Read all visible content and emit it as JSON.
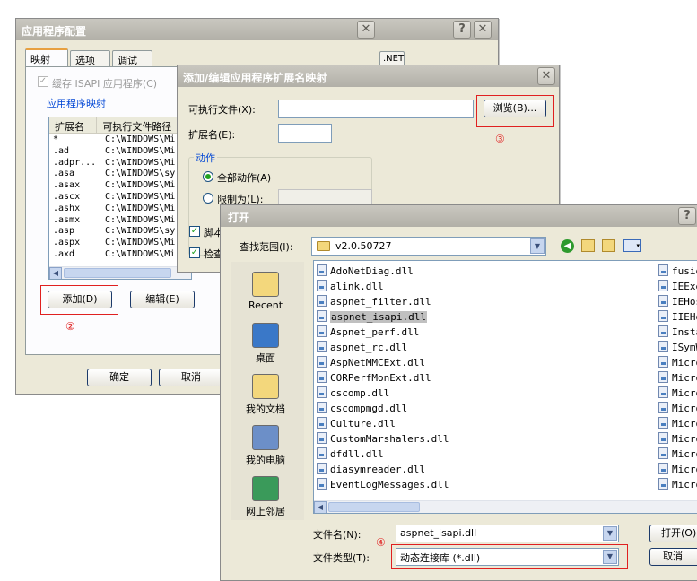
{
  "app_config": {
    "title": "应用程序配置",
    "tabs": [
      "映射",
      "选项",
      "调试"
    ],
    "cache_isapi_label": "缓存 ISAPI 应用程序(C)",
    "group_title": "应用程序映射",
    "columns": [
      "扩展名",
      "可执行文件路径"
    ],
    "rows": [
      {
        "ext": "*",
        "path": "C:\\WINDOWS\\Mi"
      },
      {
        "ext": ".ad",
        "path": "C:\\WINDOWS\\Mi"
      },
      {
        "ext": ".adpr...",
        "path": "C:\\WINDOWS\\Mi"
      },
      {
        "ext": ".asa",
        "path": "C:\\WINDOWS\\sy"
      },
      {
        "ext": ".asax",
        "path": "C:\\WINDOWS\\Mi"
      },
      {
        "ext": ".ascx",
        "path": "C:\\WINDOWS\\Mi"
      },
      {
        "ext": ".ashx",
        "path": "C:\\WINDOWS\\Mi"
      },
      {
        "ext": ".asmx",
        "path": "C:\\WINDOWS\\Mi"
      },
      {
        "ext": ".asp",
        "path": "C:\\WINDOWS\\sy"
      },
      {
        "ext": ".aspx",
        "path": "C:\\WINDOWS\\Mi"
      },
      {
        "ext": ".axd",
        "path": "C:\\WINDOWS\\Mi"
      }
    ],
    "add_button": "添加(D)",
    "edit_button": "编辑(E)",
    "ok_button": "确定",
    "cancel_button": "取消",
    "annotation_2": "②",
    "bg_tab": ".NET"
  },
  "ext_dialog": {
    "title": "添加/编辑应用程序扩展名映射",
    "executable_label": "可执行文件(X):",
    "executable_value": "",
    "browse_button": "浏览(B)...",
    "annotation_3": "③",
    "extension_label": "扩展名(E):",
    "extension_value": "",
    "verbs_group": "动作",
    "all_verbs": "全部动作(A)",
    "limit_to": "限制为(L):",
    "script_engine": "脚本",
    "check_file": "检查"
  },
  "open_dialog": {
    "title": "打开",
    "look_in_label": "查找范围(I):",
    "look_in_value": "v2.0.50727",
    "places": [
      "Recent",
      "桌面",
      "我的文档",
      "我的电脑",
      "网上邻居"
    ],
    "files_col1": [
      "AdoNetDiag.dll",
      "alink.dll",
      "aspnet_filter.dll",
      "aspnet_isapi.dll",
      "Aspnet_perf.dll",
      "aspnet_rc.dll",
      "AspNetMMCExt.dll",
      "CORPerfMonExt.dll",
      "cscomp.dll",
      "cscompmgd.dll",
      "Culture.dll",
      "CustomMarshalers.dll",
      "dfdll.dll",
      "diasymreader.dll",
      "EventLogMessages.dll"
    ],
    "files_col2": [
      "fusio",
      "IEExe",
      "IEHos",
      "IIEHo",
      "Insta",
      "ISymW",
      "Micro",
      "Micro",
      "Micro",
      "Micro",
      "Micro",
      "Micro",
      "Micro",
      "Micro",
      "Micro"
    ],
    "selected_file": "aspnet_isapi.dll",
    "filename_label": "文件名(N):",
    "filename_value": "aspnet_isapi.dll",
    "filetype_label": "文件类型(T):",
    "filetype_value": "动态连接库 (*.dll)",
    "open_button": "打开(O)",
    "cancel_button": "取消",
    "annotation_4": "④"
  }
}
